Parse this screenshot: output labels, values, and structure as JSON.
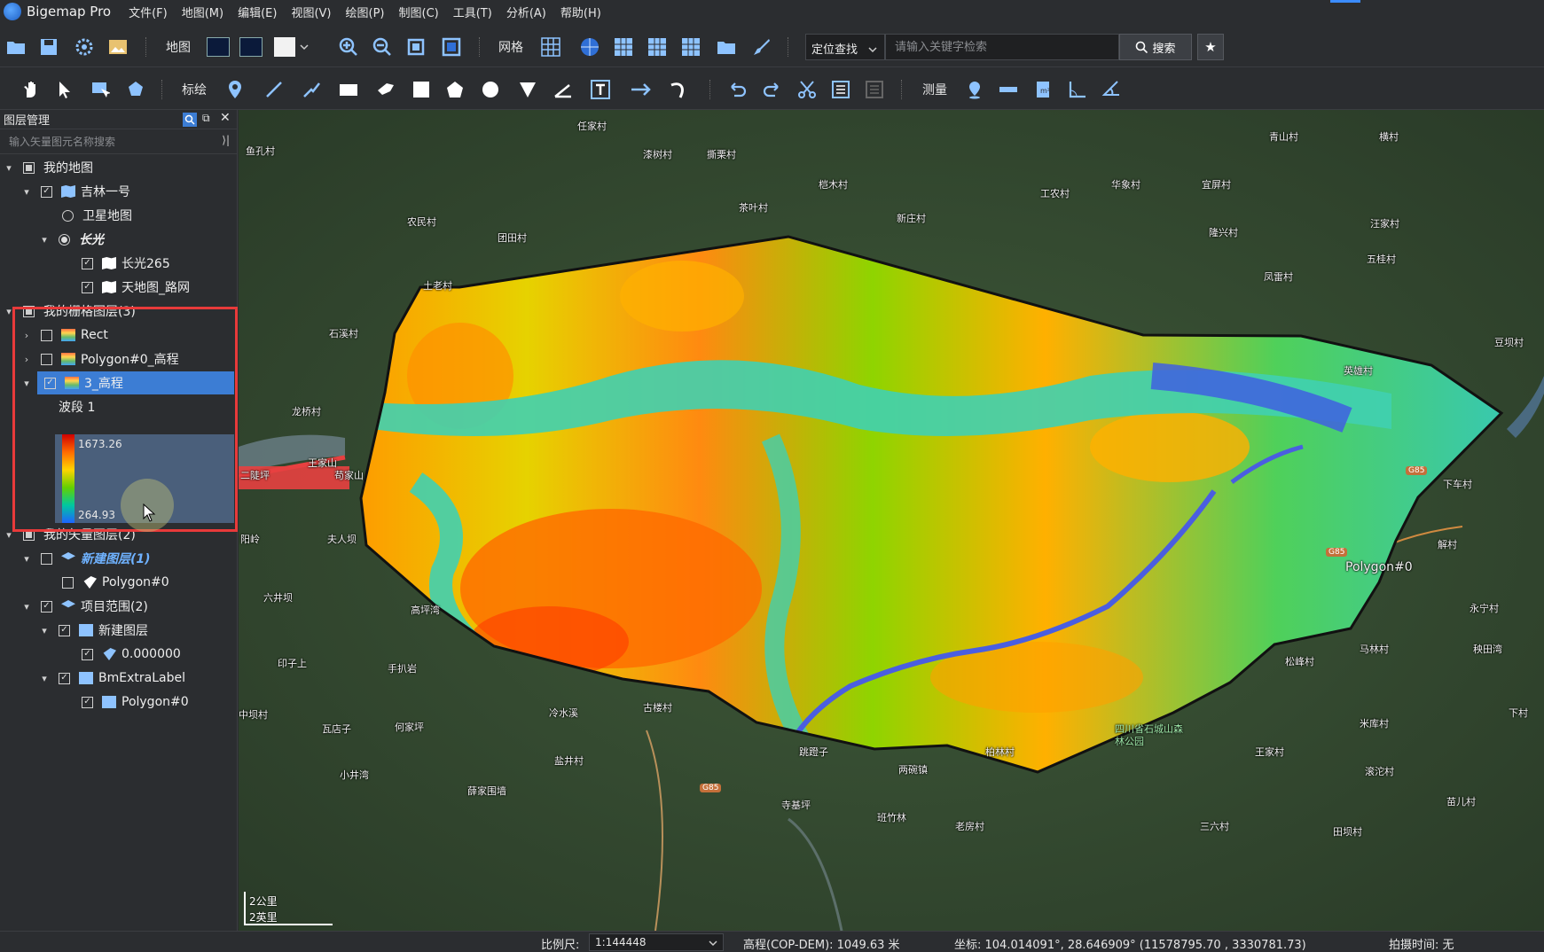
{
  "app": {
    "title": "Bigemap Pro"
  },
  "menu": [
    "文件(F)",
    "地图(M)",
    "编辑(E)",
    "视图(V)",
    "绘图(P)",
    "制图(C)",
    "工具(T)",
    "分析(A)",
    "帮助(H)"
  ],
  "toolbar1": {
    "map_label": "地图",
    "grid_label": "网格",
    "search_type": "定位查找",
    "search_placeholder": "请输入关键字检索",
    "search_button": "搜索"
  },
  "toolbar2": {
    "plot_label": "标绘",
    "measure_label": "测量"
  },
  "panel": {
    "title": "图层管理",
    "search_placeholder": "输入矢量图元名称搜索",
    "tree": {
      "my_map": "我的地图",
      "jilin": "吉林一号",
      "satellite": "卫星地图",
      "changguang": "长光",
      "cg265": "长光265",
      "tianditu": "天地图_路网",
      "raster_group": "我的栅格图层(3)",
      "rect": "Rect",
      "polygon_dem": "Polygon#0_高程",
      "dem3": "3_高程",
      "band": "波段 1",
      "legend_max": "1673.26",
      "legend_min": "264.93",
      "vector_group": "我的矢量图层(2)",
      "new_layer_1": "新建图层(1)",
      "polygon0": "Polygon#0",
      "project_range": "项目范围(2)",
      "new_layer": "新建图层",
      "zero": "0.000000",
      "bmextra": "BmExtraLabel",
      "polygon0b": "Polygon#0"
    }
  },
  "map_labels": {
    "villages": [
      "任家村",
      "鱼孔村",
      "漆树村",
      "撕栗村",
      "桤木村",
      "茶叶村",
      "工农村",
      "华象村",
      "宜屏村",
      "青山村",
      "横村",
      "农民村",
      "团田村",
      "新庄村",
      "隆兴村",
      "汪家村",
      "土老村",
      "凤雷村",
      "五桂村",
      "石溪村",
      "豆坝村",
      "英雄村",
      "龙桥村",
      "王家山",
      "苟家山",
      "下车村",
      "二陡坪",
      "夫人坝",
      "解村",
      "六井坝",
      "永宁村",
      "高坪湾",
      "马林村",
      "松峰村",
      "秧田湾",
      "印子上",
      "手扒岩",
      "中坝村",
      "古楼村",
      "冷水溪",
      "米库村",
      "下村",
      "瓦店子",
      "何家坪",
      "跳蹬子",
      "柏林村",
      "王家村",
      "盐井村",
      "两碗镇",
      "滚沱村",
      "小井湾",
      "薛家围墙",
      "寺基坪",
      "班竹林",
      "老房村",
      "三六村",
      "苗儿村",
      "田坝村",
      "阳岭"
    ],
    "park": "四川省石城山森林公园",
    "polygon_label": "Polygon#0",
    "road": "G85",
    "scale_km": "2公里",
    "scale_mi": "2英里"
  },
  "status": {
    "scale_label": "比例尺:",
    "scale_value": "1:144448",
    "elevation": "高程(COP-DEM): 1049.63 米",
    "coords": "坐标: 104.014091°, 28.646909°  (11578795.70 , 3330781.73)",
    "capture_time": "拍摄时间: 无"
  }
}
